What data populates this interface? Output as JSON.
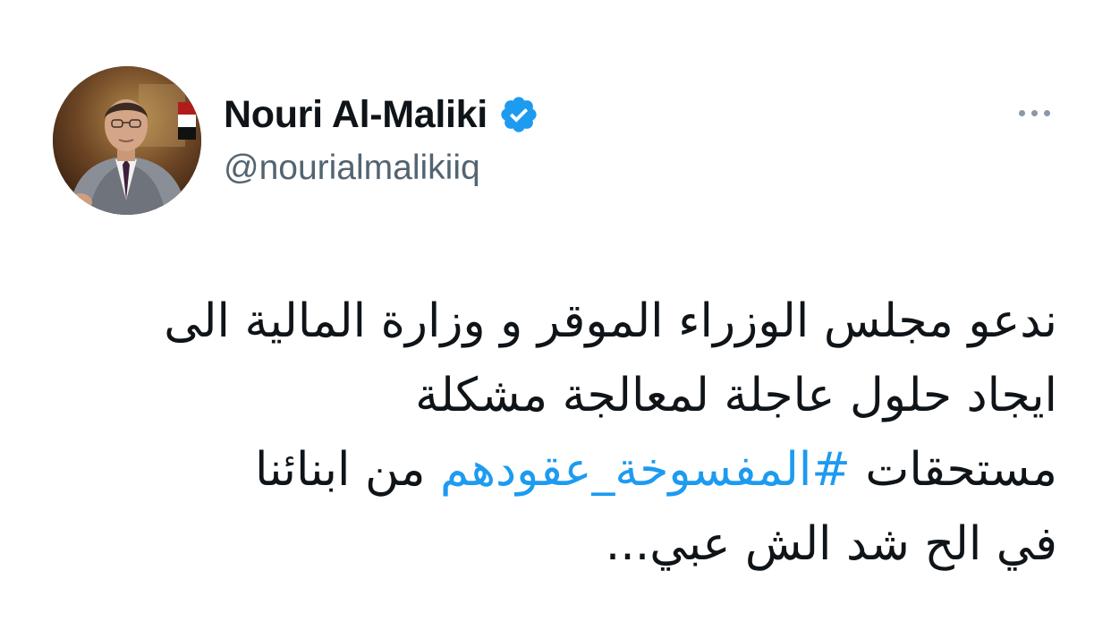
{
  "user": {
    "display_name": "Nouri Al-Maliki",
    "handle": "@nourialmalikiiq",
    "verified": true,
    "verified_icon": "verified-badge-icon",
    "avatar_icon": "profile-photo"
  },
  "menu": {
    "more_icon": "more-horizontal-icon"
  },
  "tweet": {
    "line1": "ندعو  مجلس الوزراء الموقر و وزارة المالية الى",
    "line2": "ايجاد حلول عاجلة لمعالجة مشكلة",
    "line3_before": "مستحقات ",
    "hashtag": "#المفسوخة_عقودهم",
    "line3_after": " من ابنائنا",
    "line4": "في الح شد الش عبي..."
  },
  "colors": {
    "text": "#0f1419",
    "secondary_text": "#536471",
    "link": "#1d9bf0",
    "verified": "#1d9bf0",
    "background": "#ffffff"
  }
}
